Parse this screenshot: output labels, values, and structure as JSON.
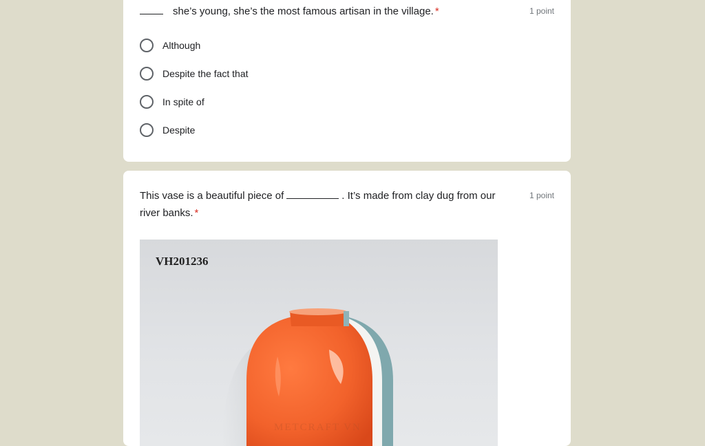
{
  "question1": {
    "text": "she’s young, she’s the most famous artisan in the village.",
    "required_mark": "*",
    "points": "1 point",
    "options": [
      "Although",
      "Despite the fact that",
      "In spite of",
      "Despite"
    ]
  },
  "question2": {
    "text_before": "This vase is a beautiful piece of",
    "text_after": ". It’s made from clay dug from our river banks.",
    "required_mark": "*",
    "points": "1 point",
    "image": {
      "product_code": "VH201236",
      "watermark": "METCRAFT VN"
    }
  },
  "colors": {
    "background": "#dedccb",
    "card": "#ffffff",
    "required": "#d93025",
    "vase_orange": "#f2622b"
  }
}
